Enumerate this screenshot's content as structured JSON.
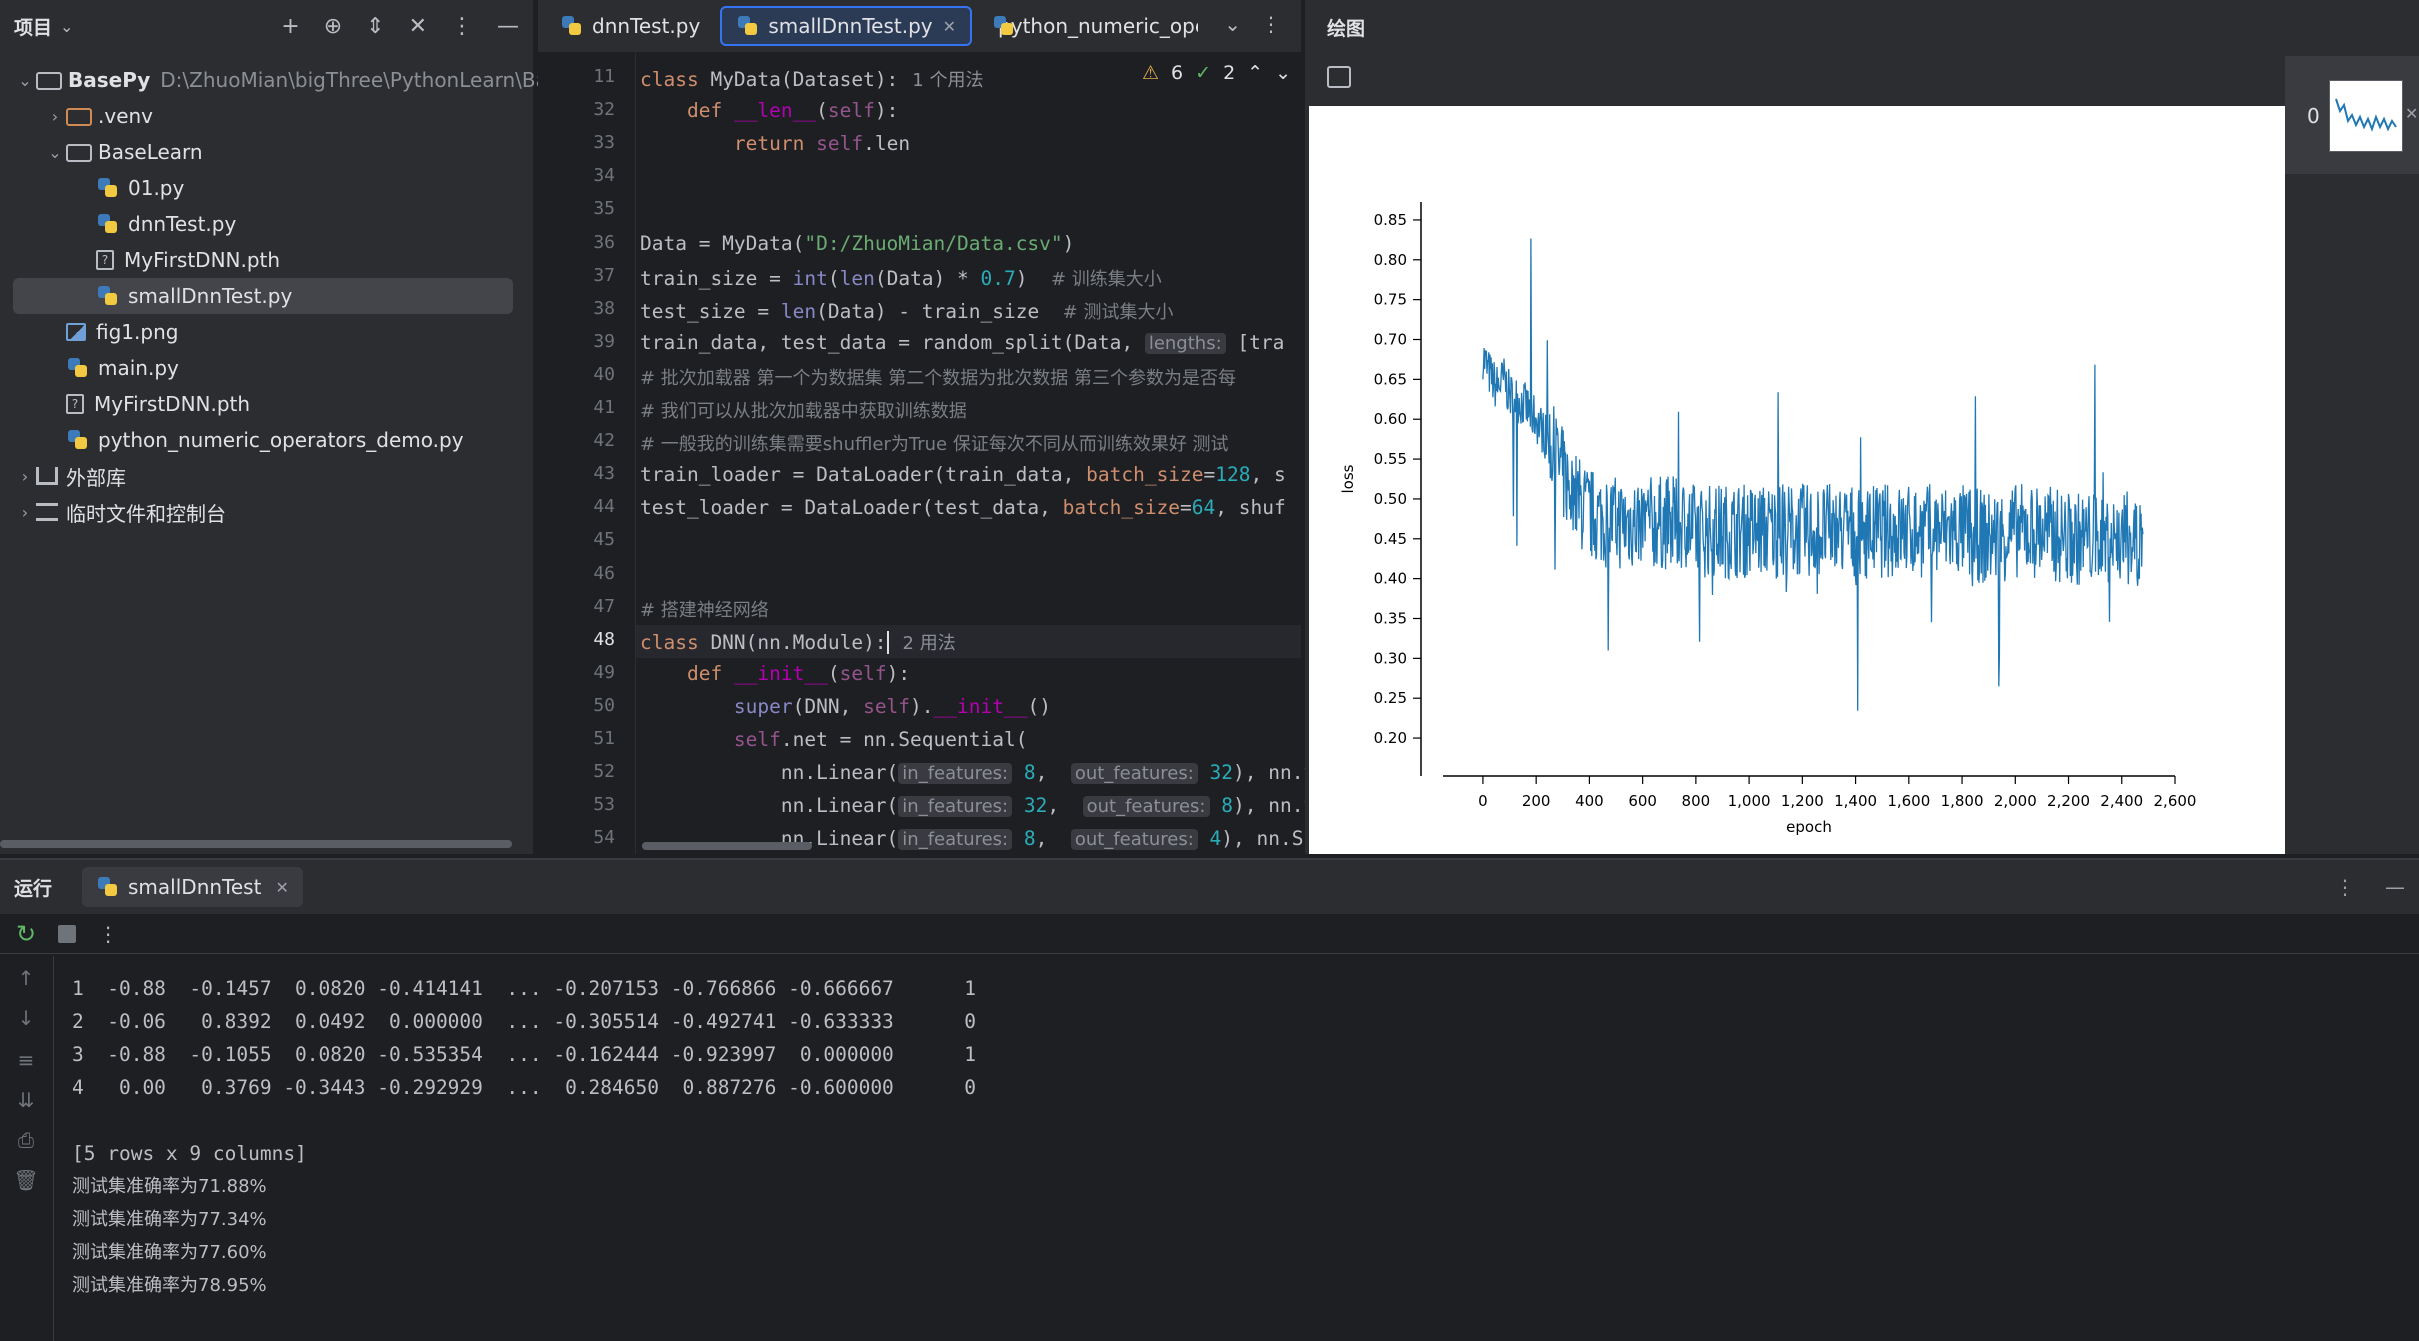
{
  "project": {
    "title": "项目",
    "tree": [
      {
        "label": "BasePy",
        "path": "D:\\ZhuoMian\\bigThree\\PythonLearn\\BasePy",
        "type": "folder",
        "depth": 0,
        "expanded": true,
        "bold": true
      },
      {
        "label": ".venv",
        "type": "folder-excluded",
        "depth": 1,
        "expanded": false
      },
      {
        "label": "BaseLearn",
        "type": "folder",
        "depth": 1,
        "expanded": true
      },
      {
        "label": "01.py",
        "type": "py",
        "depth": 2
      },
      {
        "label": "dnnTest.py",
        "type": "py",
        "depth": 2
      },
      {
        "label": "MyFirstDNN.pth",
        "type": "pth",
        "depth": 2
      },
      {
        "label": "smallDnnTest.py",
        "type": "py",
        "depth": 2,
        "selected": true
      },
      {
        "label": "fig1.png",
        "type": "png",
        "depth": 1
      },
      {
        "label": "main.py",
        "type": "py",
        "depth": 1
      },
      {
        "label": "MyFirstDNN.pth",
        "type": "pth",
        "depth": 1
      },
      {
        "label": "python_numeric_operators_demo.py",
        "type": "py",
        "depth": 1
      },
      {
        "label": "外部库",
        "type": "lib",
        "depth": 0,
        "expanded": false
      },
      {
        "label": "临时文件和控制台",
        "type": "scratch",
        "depth": 0,
        "expanded": false
      }
    ]
  },
  "editor": {
    "tabs": [
      {
        "label": "dnnTest.py",
        "active": false
      },
      {
        "label": "smallDnnTest.py",
        "active": true
      },
      {
        "label": "python_numeric_opera",
        "active": false
      }
    ],
    "inspections": {
      "warnings": "6",
      "ok": "2"
    },
    "sticky": {
      "line": "11",
      "text_kw": "class ",
      "text_name": "MyData",
      "text_rest": "(Dataset):",
      "usage": "1 个用法"
    },
    "lines": {
      "n": [
        "32",
        "33",
        "34",
        "35",
        "36",
        "37",
        "38",
        "39",
        "40",
        "41",
        "42",
        "43",
        "44",
        "45",
        "46",
        "47",
        "48",
        "49",
        "50",
        "51",
        "52",
        "53",
        "54"
      ],
      "c37": "# 训练集大小",
      "c38": "# 测试集大小",
      "c40": "# 批次加载器 第一个为数据集 第二个数据为批次数据 第三个参数为是否每",
      "c41": "# 我们可以从批次加载器中获取训练数据",
      "c42": "# 一般我的训练集需要shuffler为True 保证每次不同从而训练效果好 测试",
      "c47": "# 搭建神经网络",
      "usage48": "2 用法",
      "path36": "\"D:/ZhuoMian/Data.csv\"",
      "hint_lengths": "lengths:",
      "hint_batch": "batch_size",
      "hint_in": "in_features:",
      "hint_out": "out_features:"
    }
  },
  "plot": {
    "title": "绘图",
    "thumb_index": "0"
  },
  "chart_data": {
    "type": "line",
    "title": "",
    "xlabel": "epoch",
    "ylabel": "loss",
    "xlim": [
      -150,
      2600
    ],
    "ylim": [
      0.18,
      0.87
    ],
    "xticks": [
      "0",
      "200",
      "400",
      "600",
      "800",
      "1,000",
      "1,200",
      "1,400",
      "1,600",
      "1,800",
      "2,000",
      "2,200",
      "2,400",
      "2,600"
    ],
    "yticks": [
      "0.20",
      "0.25",
      "0.30",
      "0.35",
      "0.40",
      "0.45",
      "0.50",
      "0.55",
      "0.60",
      "0.65",
      "0.70",
      "0.75",
      "0.80",
      "0.85"
    ],
    "color": "#1f77b4",
    "series": [
      {
        "x": [
          0,
          20,
          50,
          80,
          100,
          150,
          200,
          250,
          300,
          350,
          400,
          500,
          600,
          700,
          800,
          900,
          1000,
          1100,
          1200,
          1300,
          1400,
          1500,
          1600,
          1700,
          1800,
          1900,
          2000,
          2100,
          2200,
          2300,
          2400,
          2480
        ],
        "y": [
          0.68,
          0.66,
          0.64,
          0.65,
          0.63,
          0.62,
          0.6,
          0.57,
          0.53,
          0.5,
          0.48,
          0.47,
          0.47,
          0.47,
          0.46,
          0.46,
          0.46,
          0.46,
          0.46,
          0.46,
          0.46,
          0.46,
          0.46,
          0.46,
          0.46,
          0.45,
          0.46,
          0.46,
          0.45,
          0.45,
          0.45,
          0.45
        ],
        "max": 0.85,
        "min": 0.21
      }
    ]
  },
  "run": {
    "title": "运行",
    "tab_label": "smallDnnTest",
    "console": [
      "1  -0.88  -0.1457  0.0820 -0.414141  ... -0.207153 -0.766866 -0.666667      1",
      "2  -0.06   0.8392  0.0492  0.000000  ... -0.305514 -0.492741 -0.633333      0",
      "3  -0.88  -0.1055  0.0820 -0.535354  ... -0.162444 -0.923997  0.000000      1",
      "4   0.00   0.3769 -0.3443 -0.292929  ...  0.284650  0.887276 -0.600000      0",
      "",
      "[5 rows x 9 columns]",
      "测试集准确率为71.88%",
      "测试集准确率为77.34%",
      "测试集准确率为77.60%",
      "测试集准确率为78.95%"
    ]
  }
}
